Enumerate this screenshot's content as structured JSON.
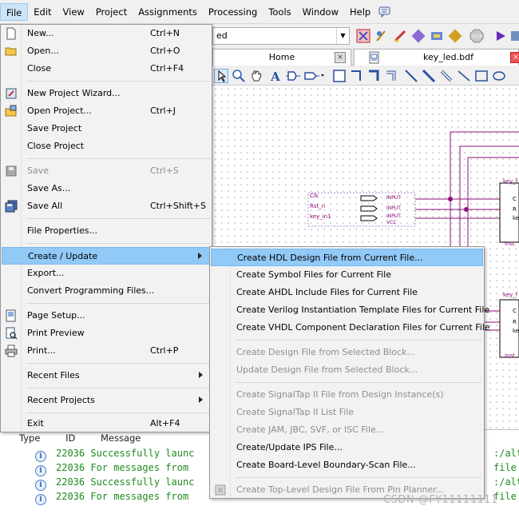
{
  "menubar": {
    "items": [
      "File",
      "Edit",
      "View",
      "Project",
      "Assignments",
      "Processing",
      "Tools",
      "Window",
      "Help"
    ]
  },
  "toolbar": {
    "combo_value": "ed"
  },
  "tabs": {
    "home": "Home",
    "file": "key_led.bdf",
    "close_glyph": "×"
  },
  "schematic": {
    "inputs": [
      "Clk",
      "Rst_n",
      "key_in1"
    ],
    "pin_tags": [
      "INPUT",
      "INPUT",
      "INPUT",
      "VCC"
    ],
    "block_top_label": "key_f",
    "block_bottom_label": "key_f",
    "block_pins": [
      "C",
      "R",
      "ke"
    ],
    "inst_label": "inst"
  },
  "file_menu": {
    "items": [
      {
        "label": "New...",
        "shortcut": "Ctrl+N"
      },
      {
        "label": "Open...",
        "shortcut": "Ctrl+O"
      },
      {
        "label": "Close",
        "shortcut": "Ctrl+F4"
      },
      {
        "label": "New Project Wizard..."
      },
      {
        "label": "Open Project...",
        "shortcut": "Ctrl+J"
      },
      {
        "label": "Save Project"
      },
      {
        "label": "Close Project"
      },
      {
        "label": "Save",
        "shortcut": "Ctrl+S"
      },
      {
        "label": "Save As..."
      },
      {
        "label": "Save All",
        "shortcut": "Ctrl+Shift+S"
      },
      {
        "label": "File Properties..."
      },
      {
        "label": "Create / Update"
      },
      {
        "label": "Export..."
      },
      {
        "label": "Convert Programming Files..."
      },
      {
        "label": "Page Setup..."
      },
      {
        "label": "Print Preview"
      },
      {
        "label": "Print...",
        "shortcut": "Ctrl+P"
      },
      {
        "label": "Recent Files"
      },
      {
        "label": "Recent Projects"
      },
      {
        "label": "Exit",
        "shortcut": "Alt+F4"
      }
    ]
  },
  "submenu": {
    "items": [
      {
        "label": "Create HDL Design File from Current File..."
      },
      {
        "label": "Create Symbol Files for Current File"
      },
      {
        "label": "Create AHDL Include Files for Current File"
      },
      {
        "label": "Create Verilog Instantiation Template Files for Current File"
      },
      {
        "label": "Create VHDL Component Declaration Files for Current File"
      },
      {
        "label": "Create Design File from Selected Block..."
      },
      {
        "label": "Update Design File from Selected Block..."
      },
      {
        "label": "Create SignalTap II File from Design Instance(s)"
      },
      {
        "label": "Create SignalTap II List File"
      },
      {
        "label": "Create JAM, JBC, SVF, or ISC File..."
      },
      {
        "label": "Create/Update IPS File..."
      },
      {
        "label": "Create Board-Level Boundary-Scan File..."
      },
      {
        "label": "Create Top-Level Design File From Pin Planner..."
      }
    ]
  },
  "messages": {
    "headers": [
      "Type",
      "ID",
      "Message"
    ],
    "rows": [
      {
        "id": "22036",
        "text": "Successfully launc",
        "right": ":/alte"
      },
      {
        "id": "22036",
        "text": "For messages from ",
        "right": "file"
      },
      {
        "id": "22036",
        "text": "Successfully launc",
        "right": ":/alte"
      },
      {
        "id": "22036",
        "text": "For messages from ",
        "right": "file"
      }
    ]
  },
  "watermark": "CSDN @FY11111111",
  "colors": {
    "highlight": "#91c9f7",
    "disabled_text": "#8d8d8d",
    "message_text": "#1e8a1e",
    "wire": "#8b0f7a"
  }
}
